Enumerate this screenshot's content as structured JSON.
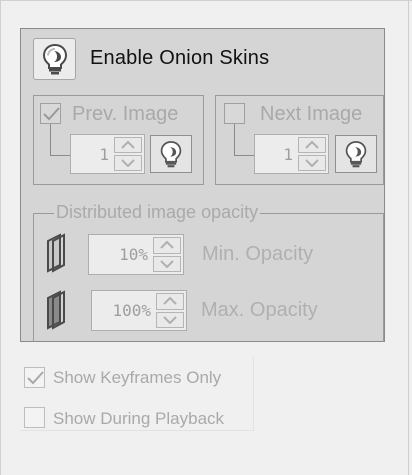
{
  "onion": {
    "enable_label": "Enable Onion Skins",
    "enable_icon": "lightbulb-icon",
    "prev": {
      "label": "Prev. Image",
      "checked": true,
      "count": "1"
    },
    "next": {
      "label": "Next Image",
      "checked": false,
      "count": "1"
    },
    "distributed": {
      "label": "Distributed image opacity",
      "min_value": "10%",
      "min_label": "Min. Opacity",
      "max_value": "100%",
      "max_label": "Max. Opacity"
    }
  },
  "options": {
    "keyframes_label": "Show Keyframes Only",
    "keyframes_checked": true,
    "playback_label": "Show During Playback",
    "playback_checked": false
  },
  "colors": {
    "panel_bg": "#d5d5d5",
    "disabled_text": "#a9a9a9",
    "window_bg": "#f0f0f0"
  }
}
